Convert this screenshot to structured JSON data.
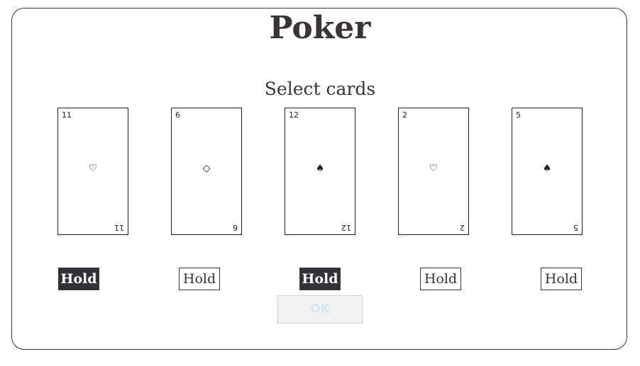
{
  "title": "Poker",
  "subtitle": "Select cards",
  "cards": [
    {
      "rank": "11",
      "suit": "♡",
      "held": true
    },
    {
      "rank": "6",
      "suit": "◇",
      "held": false
    },
    {
      "rank": "12",
      "suit": "♠",
      "held": true
    },
    {
      "rank": "2",
      "suit": "♡",
      "held": false
    },
    {
      "rank": "5",
      "suit": "♠",
      "held": false
    }
  ],
  "hold_label": "Hold",
  "ok_label": "OK",
  "colors": {
    "held_bg": "#2f323a",
    "text": "#3a3436",
    "ok_text_disabled": "#cfe9f2"
  }
}
